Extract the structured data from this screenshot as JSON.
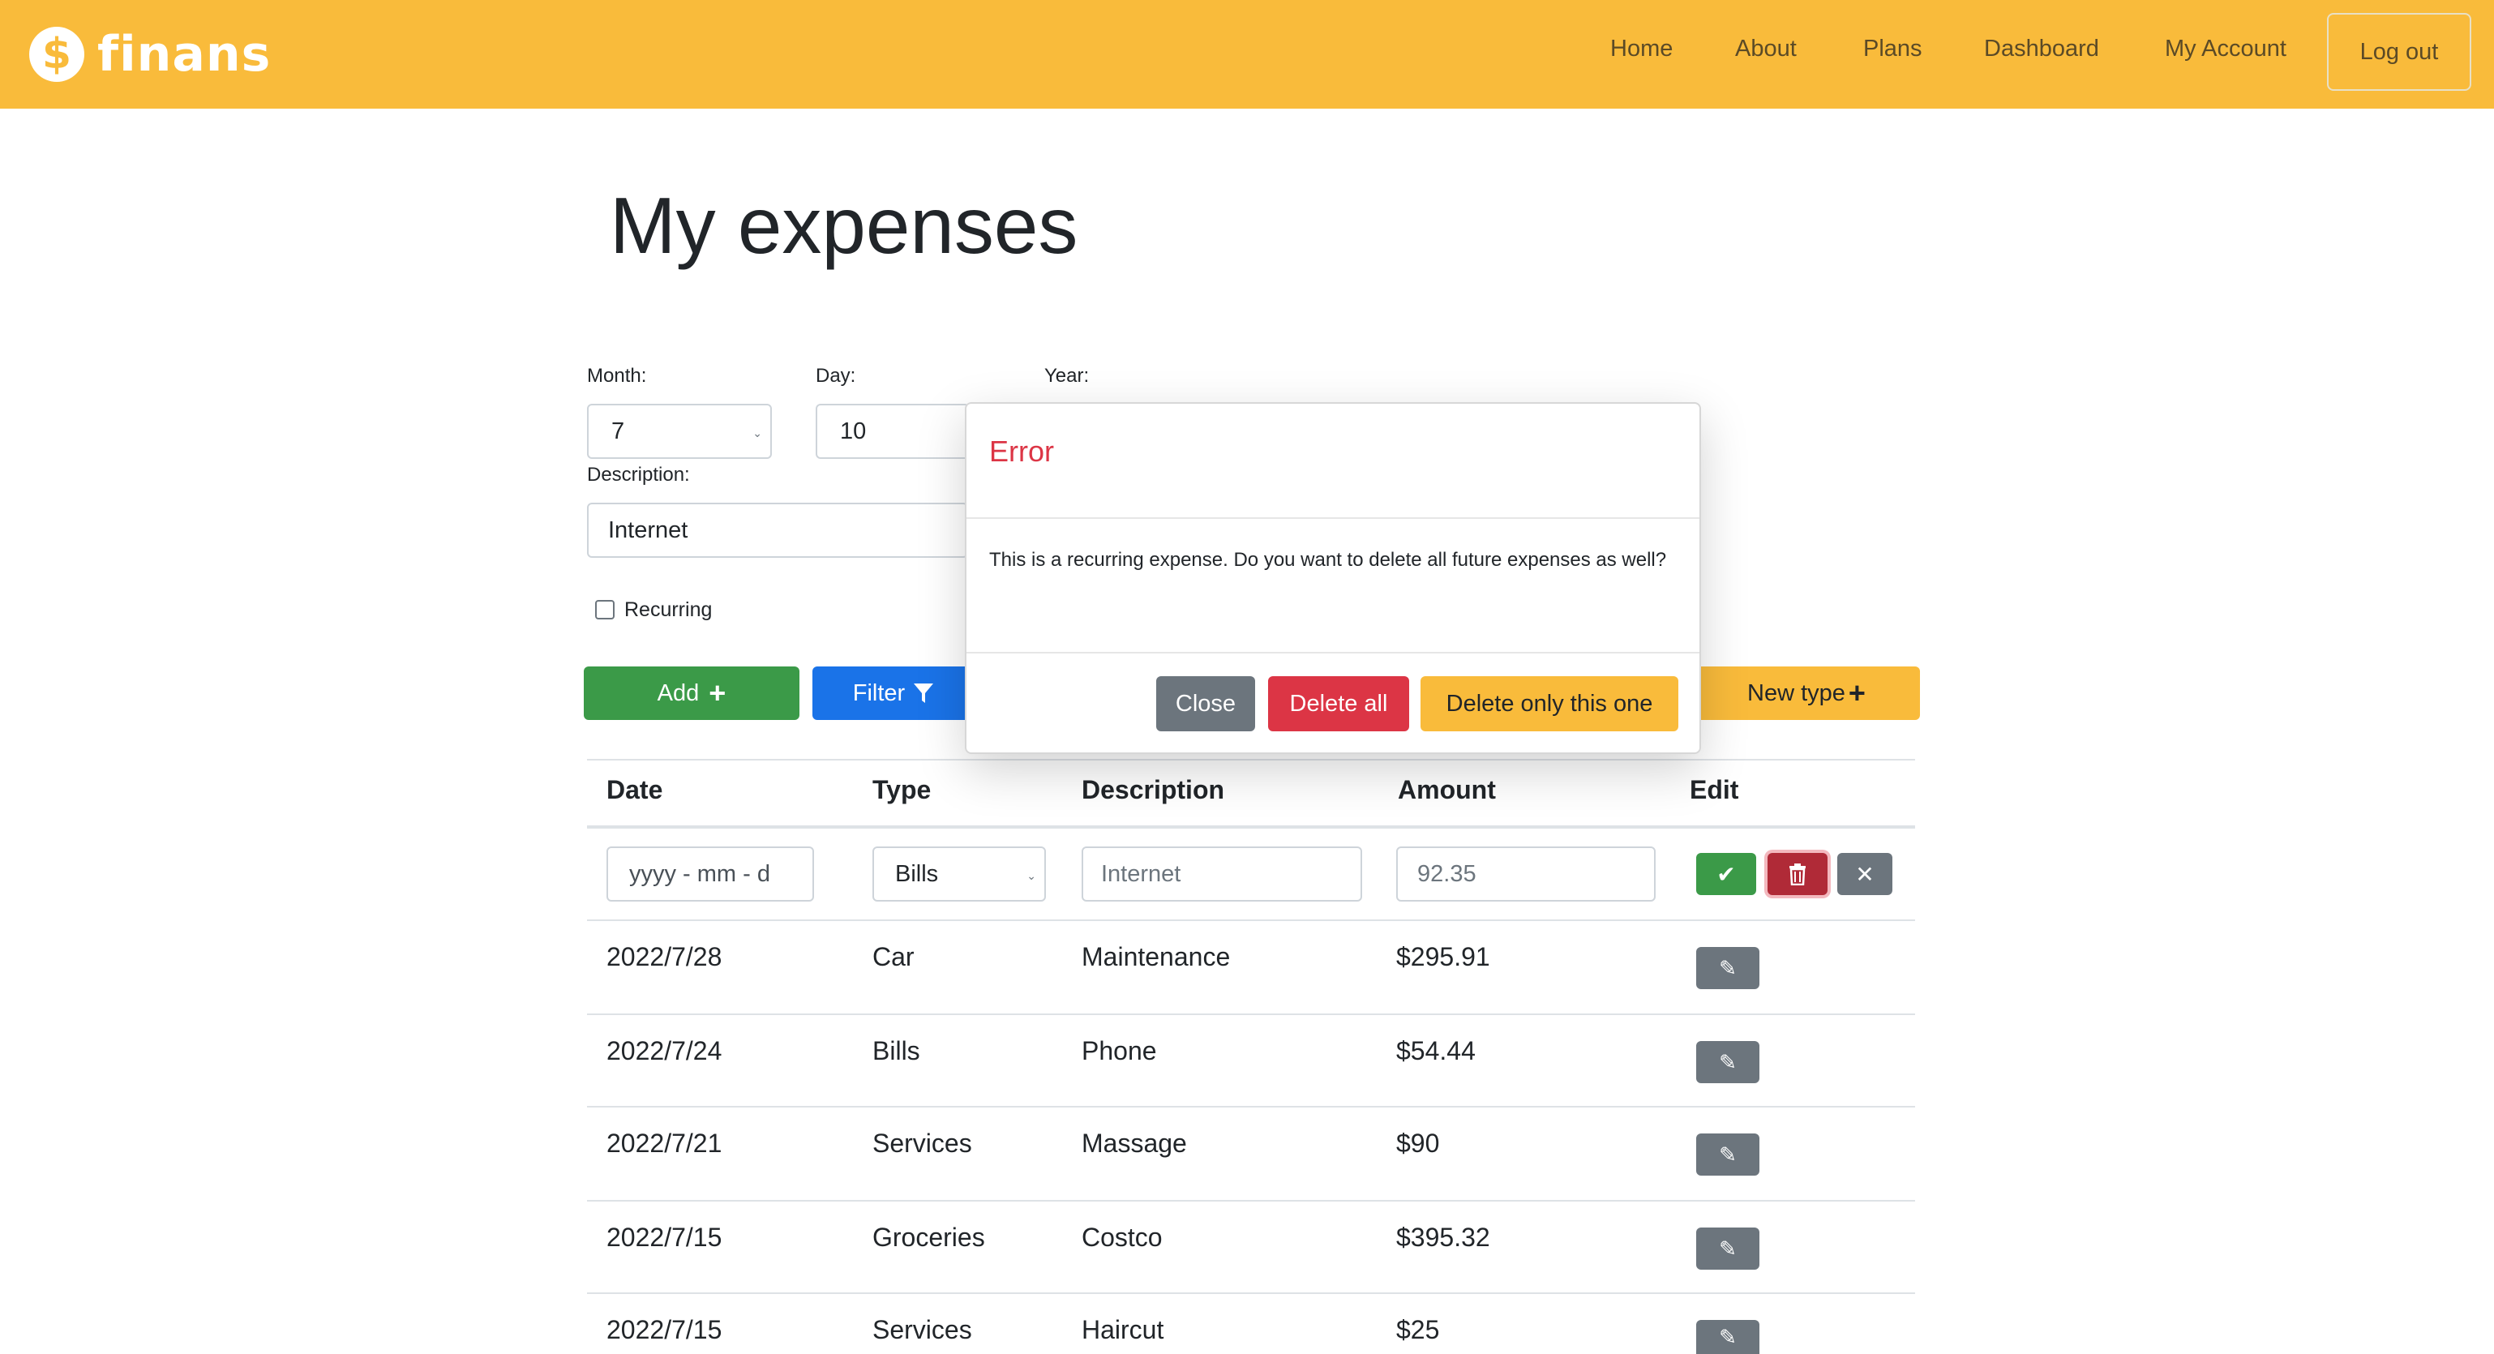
{
  "brand": {
    "logo_symbol": "$",
    "name": "finans",
    "color": "#f9bb3b"
  },
  "nav": {
    "home": "Home",
    "about": "About",
    "plans": "Plans",
    "dashboard": "Dashboard",
    "my_account": "My Account",
    "logout": "Log out"
  },
  "page": {
    "title": "My expenses"
  },
  "form": {
    "month_label": "Month:",
    "month_value": "7",
    "day_label": "Day:",
    "day_value": "10",
    "year_label": "Year:",
    "description_label": "Description:",
    "description_value": "Internet",
    "recurring_label": "Recurring",
    "recurring_checked": false,
    "add_label": "Add",
    "filter_label": "Filter",
    "new_type_label": "New type"
  },
  "table": {
    "headers": {
      "date": "Date",
      "type": "Type",
      "description": "Description",
      "amount": "Amount",
      "edit": "Edit"
    },
    "edit_row": {
      "date_placeholder": "yyyy - mm - d",
      "type_value": "Bills",
      "description_value": "Internet",
      "amount_value": "92.35"
    },
    "rows": [
      {
        "date": "2022/7/28",
        "type": "Car",
        "description": "Maintenance",
        "amount": "$295.91"
      },
      {
        "date": "2022/7/24",
        "type": "Bills",
        "description": "Phone",
        "amount": "$54.44"
      },
      {
        "date": "2022/7/21",
        "type": "Services",
        "description": "Massage",
        "amount": "$90"
      },
      {
        "date": "2022/7/15",
        "type": "Groceries",
        "description": "Costco",
        "amount": "$395.32"
      },
      {
        "date": "2022/7/15",
        "type": "Services",
        "description": "Haircut",
        "amount": "$25"
      }
    ]
  },
  "modal": {
    "title": "Error",
    "body": "This is a recurring expense. Do you want to delete all future expenses as well?",
    "close_label": "Close",
    "delete_all_label": "Delete all",
    "delete_one_label": "Delete only this one"
  },
  "colors": {
    "primary": "#1a73e8",
    "success": "#3b9a48",
    "danger": "#dc3545",
    "secondary": "#6c757d",
    "warning": "#f9bb3b"
  }
}
